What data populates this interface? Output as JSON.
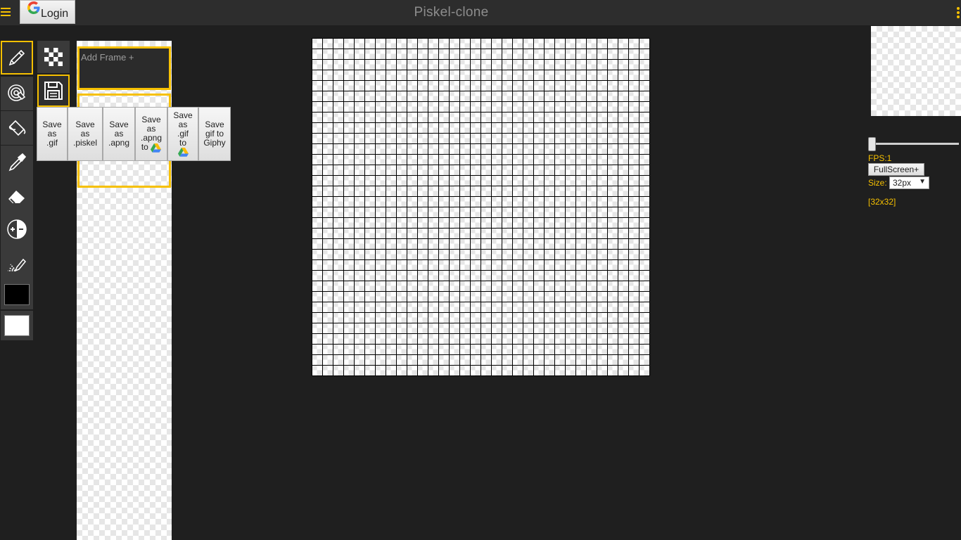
{
  "header": {
    "title": "Piskel-clone",
    "login_label": "Login",
    "login_logo": "G"
  },
  "colors": {
    "accent": "#f6c000",
    "primary_color": "#000000",
    "secondary_color": "#ffffff"
  },
  "tools": [
    {
      "name": "pen-icon",
      "active": true
    },
    {
      "name": "paint-bucket-target-icon",
      "active": false
    },
    {
      "name": "paint-bucket-icon",
      "active": false
    },
    {
      "name": "eyedropper-icon",
      "active": false
    },
    {
      "name": "eraser-icon",
      "active": false
    },
    {
      "name": "lighten-darken-icon",
      "active": false
    },
    {
      "name": "mirror-pen-icon",
      "active": false
    }
  ],
  "frames": {
    "add_frame_label": "Add Frame +"
  },
  "save_menu": [
    {
      "lines": [
        "Save",
        "as",
        ".gif"
      ],
      "drive": false
    },
    {
      "lines": [
        "Save",
        "as",
        ".piskel"
      ],
      "drive": false
    },
    {
      "lines": [
        "Save",
        "as",
        ".apng"
      ],
      "drive": false
    },
    {
      "lines": [
        "Save",
        "as",
        ".apng",
        "to"
      ],
      "drive": true
    },
    {
      "lines": [
        "Save",
        "as",
        ".gif",
        "to"
      ],
      "drive": true
    },
    {
      "lines": [
        "Save",
        "gif to",
        "Giphy"
      ],
      "drive": false
    }
  ],
  "canvas": {
    "grid_cells": 32
  },
  "preview": {
    "fps_label": "FPS:1",
    "fps_value": 1,
    "fullscreen_label": "FullScreen+",
    "size_label": "Size:",
    "size_value": "32px",
    "dimensions": "[32x32]"
  }
}
